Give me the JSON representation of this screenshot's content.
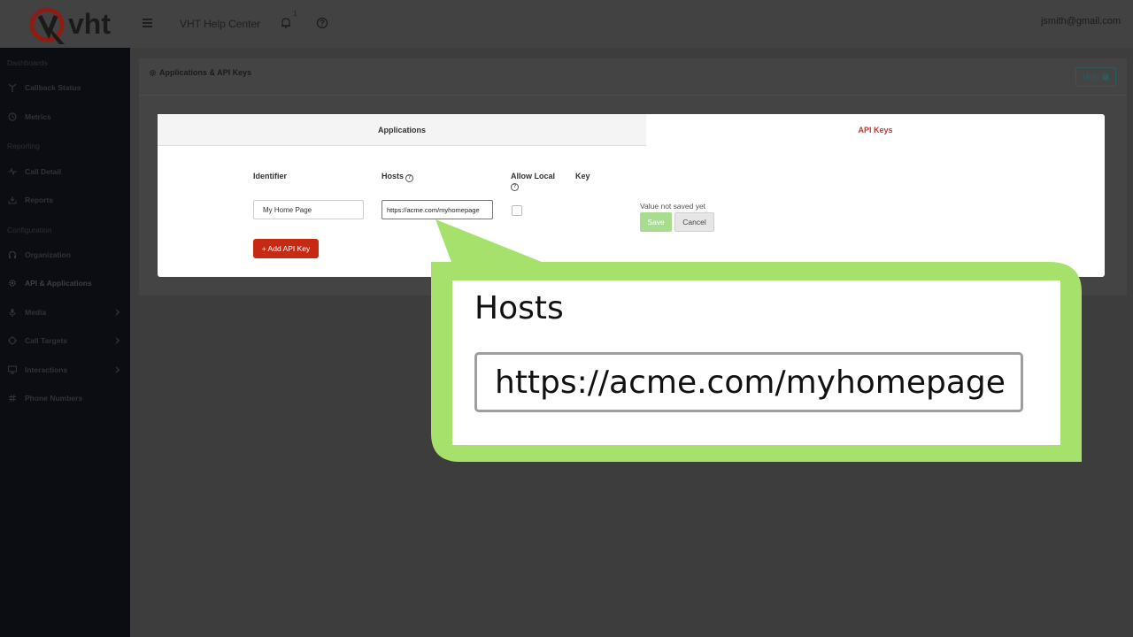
{
  "header": {
    "logo_text": "vht",
    "help_center": "VHT Help Center",
    "notification_count": "1",
    "user_email": "jsmith@gmail.com"
  },
  "sidebar": {
    "sections": {
      "dashboards": "Dashboards",
      "reporting": "Reporting",
      "configuration": "Configuration"
    },
    "items": [
      {
        "label": "Callback Status",
        "icon": "antenna-icon"
      },
      {
        "label": "Metrics",
        "icon": "clock-icon"
      },
      {
        "label": "Call Detail",
        "icon": "pulse-icon"
      },
      {
        "label": "Reports",
        "icon": "download-icon"
      },
      {
        "label": "Organization",
        "icon": "headset-icon"
      },
      {
        "label": "API & Applications",
        "icon": "gear-icon"
      },
      {
        "label": "Media",
        "icon": "microphone-icon"
      },
      {
        "label": "Call Targets",
        "icon": "target-icon"
      },
      {
        "label": "Interactions",
        "icon": "monitor-icon"
      },
      {
        "label": "Phone Numbers",
        "icon": "hash-icon"
      }
    ]
  },
  "panel": {
    "title": "Applications & API Keys",
    "help_label": "Help"
  },
  "tabs": {
    "applications": "Applications",
    "api_keys": "API Keys",
    "active": "API Keys"
  },
  "form": {
    "columns": {
      "identifier": "Identifier",
      "hosts": "Hosts",
      "allow_local": "Allow Local",
      "key": "Key"
    },
    "identifier_value": "My Home Page",
    "hosts_value": "https://acme.com/myhomepage",
    "allow_local_checked": false,
    "status": "Value not saved yet",
    "save_label": "Save",
    "cancel_label": "Cancel",
    "add_label": "+ Add API Key"
  },
  "callout": {
    "label": "Hosts",
    "value": "https://acme.com/myhomepage"
  },
  "colors": {
    "accent_red": "#c0392b",
    "add_button": "#c62a14",
    "save_button": "#a8dc8f",
    "callout_green": "#a6e26b"
  }
}
